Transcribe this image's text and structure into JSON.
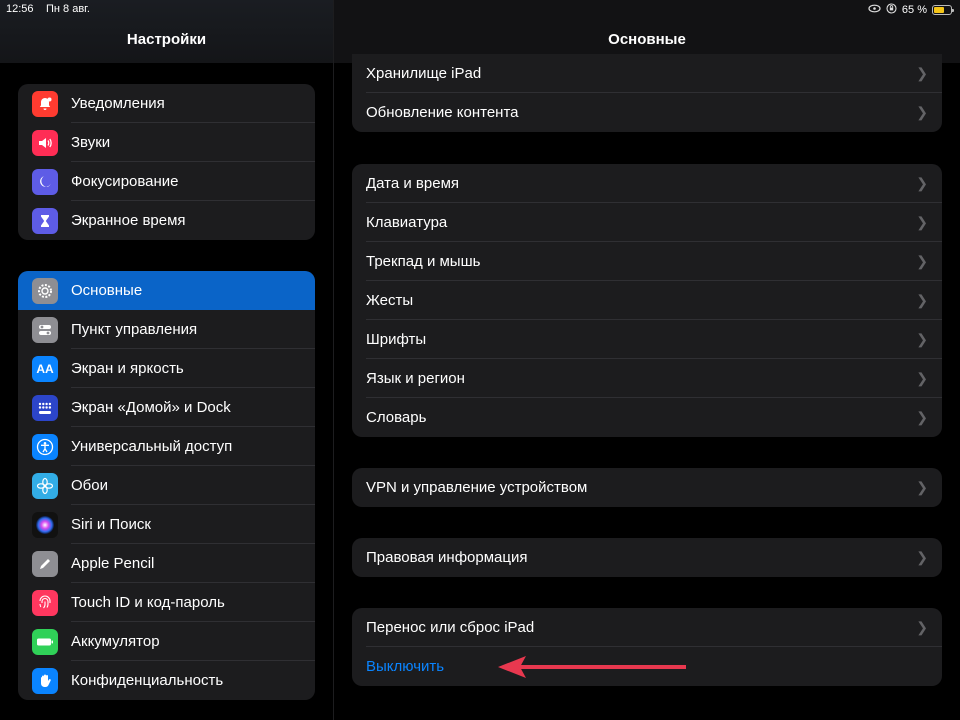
{
  "status": {
    "time": "12:56",
    "date": "Пн 8 авг.",
    "battery_text": "65 %",
    "battery_level": 0.65
  },
  "sidebar": {
    "title": "Настройки",
    "group1": [
      {
        "label": "Уведомления",
        "icon": "bell-icon",
        "color": "#ff3b30"
      },
      {
        "label": "Звуки",
        "icon": "speaker-icon",
        "color": "#ff2d55"
      },
      {
        "label": "Фокусирование",
        "icon": "moon-icon",
        "color": "#5e5ce6"
      },
      {
        "label": "Экранное время",
        "icon": "hourglass-icon",
        "color": "#5e5ce6"
      }
    ],
    "group2": [
      {
        "label": "Основные",
        "icon": "gear-icon",
        "color": "#8e8e93",
        "active": true
      },
      {
        "label": "Пункт управления",
        "icon": "toggles-icon",
        "color": "#8e8e93"
      },
      {
        "label": "Экран и яркость",
        "icon": "text-size-icon",
        "color": "#0a84ff"
      },
      {
        "label": "Экран «Домой» и Dock",
        "icon": "home-grid-icon",
        "color": "#2c45c9"
      },
      {
        "label": "Универсальный доступ",
        "icon": "accessibility-icon",
        "color": "#0a84ff"
      },
      {
        "label": "Обои",
        "icon": "flower-icon",
        "color": "#32ade6"
      },
      {
        "label": "Siri и Поиск",
        "icon": "siri-icon",
        "color": "#222"
      },
      {
        "label": "Apple Pencil",
        "icon": "pencil-icon",
        "color": "#8e8e93"
      },
      {
        "label": "Touch ID и код-пароль",
        "icon": "fingerprint-icon",
        "color": "#ff375f"
      },
      {
        "label": "Аккумулятор",
        "icon": "battery-icon",
        "color": "#30d158"
      },
      {
        "label": "Конфиденциальность",
        "icon": "hand-icon",
        "color": "#0a84ff"
      }
    ]
  },
  "main": {
    "title": "Основные",
    "group1": [
      "Хранилище iPad",
      "Обновление контента"
    ],
    "group2": [
      "Дата и время",
      "Клавиатура",
      "Трекпад и мышь",
      "Жесты",
      "Шрифты",
      "Язык и регион",
      "Словарь"
    ],
    "group3": [
      "VPN и управление устройством"
    ],
    "group4": [
      "Правовая информация"
    ],
    "group5": [
      "Перенос или сброс iPad"
    ],
    "shutdown": "Выключить",
    "arrow_color": "#e8384f"
  }
}
